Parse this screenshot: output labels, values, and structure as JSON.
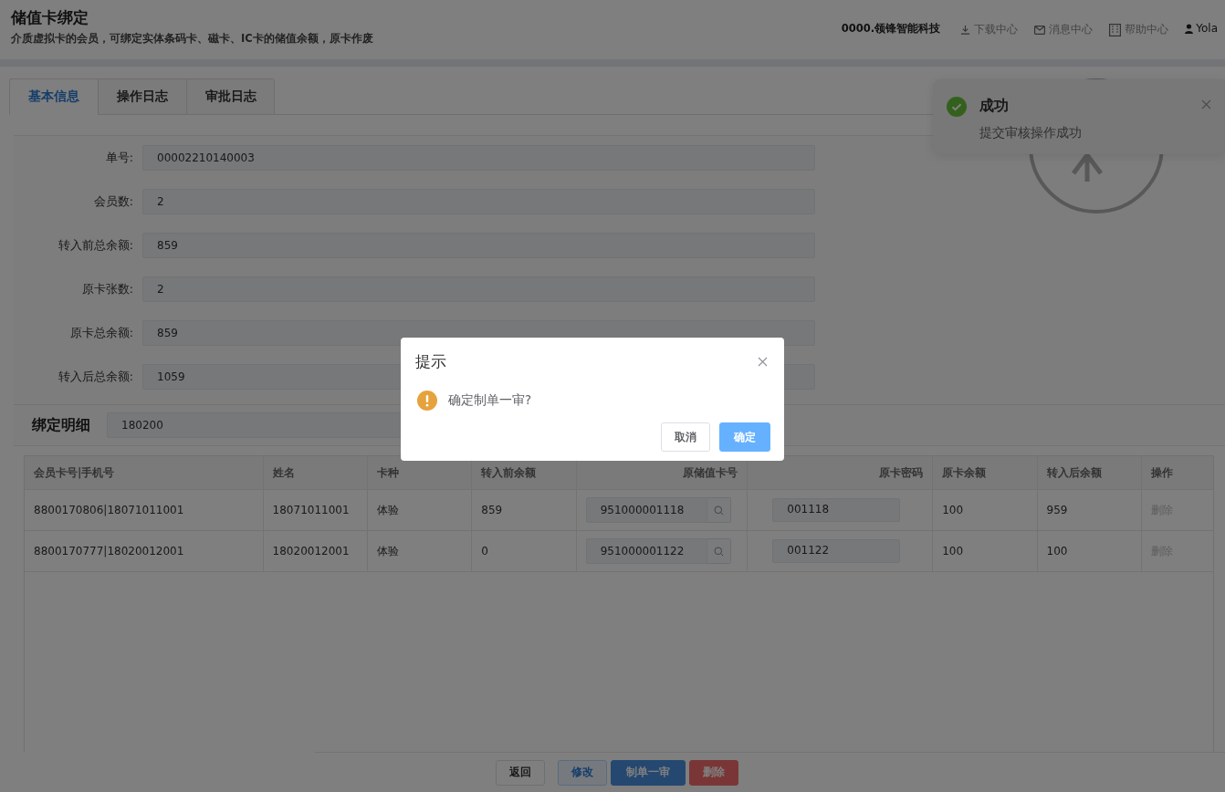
{
  "header": {
    "title": "储值卡绑定",
    "subtitle": "介质虚拟卡的会员，可绑定实体条码卡、磁卡、IC卡的储值余额，原卡作废",
    "company": "0000.领锋智能科技",
    "links": [
      {
        "label": "下载中心",
        "kind": "download"
      },
      {
        "label": "消息中心",
        "kind": "mail"
      },
      {
        "label": "帮助中心",
        "kind": "help"
      },
      {
        "label": "Yola",
        "kind": "user"
      }
    ]
  },
  "tabs": [
    {
      "label": "基本信息",
      "selected": true
    },
    {
      "label": "操作日志",
      "selected": false
    },
    {
      "label": "审批日志",
      "selected": false
    }
  ],
  "form": [
    {
      "label": "单号:",
      "value": "00002210140003"
    },
    {
      "label": "会员数:",
      "value": "2"
    },
    {
      "label": "转入前总余额:",
      "value": "859"
    },
    {
      "label": "原卡张数:",
      "value": "2"
    },
    {
      "label": "原卡总余额:",
      "value": "859"
    },
    {
      "label": "转入后总余额:",
      "value": "1059"
    }
  ],
  "detail": {
    "title": "绑定明细",
    "search_value": "180200"
  },
  "table": {
    "columns": [
      "会员卡号|手机号",
      "姓名",
      "卡种",
      "转入前余额",
      "原储值卡号",
      "原卡密码",
      "原卡余额",
      "转入后余额",
      "操作"
    ],
    "rows": [
      {
        "member": "8800170806|18071011001",
        "name": "18071011001",
        "card_type": "体验",
        "balance_before": "859",
        "card_no": "951000001118",
        "password": "001118",
        "card_balance": "100",
        "balance_after": "959",
        "action": "删除",
        "action_disabled": true
      },
      {
        "member": "8800170777|18020012001",
        "name": "18020012001",
        "card_type": "体验",
        "balance_before": "0",
        "card_no": "951000001122",
        "password": "001122",
        "card_balance": "100",
        "balance_after": "100",
        "action": "删除",
        "action_disabled": true
      }
    ]
  },
  "footer_buttons": [
    {
      "label": "返回",
      "kind": "default"
    },
    {
      "label": "修改",
      "kind": "plain"
    },
    {
      "label": "制单一审",
      "kind": "primary"
    },
    {
      "label": "删除",
      "kind": "danger"
    }
  ],
  "toast": {
    "title": "成功",
    "message": "提交审核操作成功"
  },
  "dialog": {
    "title": "提示",
    "message": "确定制单一审?",
    "buttons": [
      {
        "label": "取消",
        "kind": "default"
      },
      {
        "label": "确定",
        "kind": "primary"
      }
    ]
  }
}
